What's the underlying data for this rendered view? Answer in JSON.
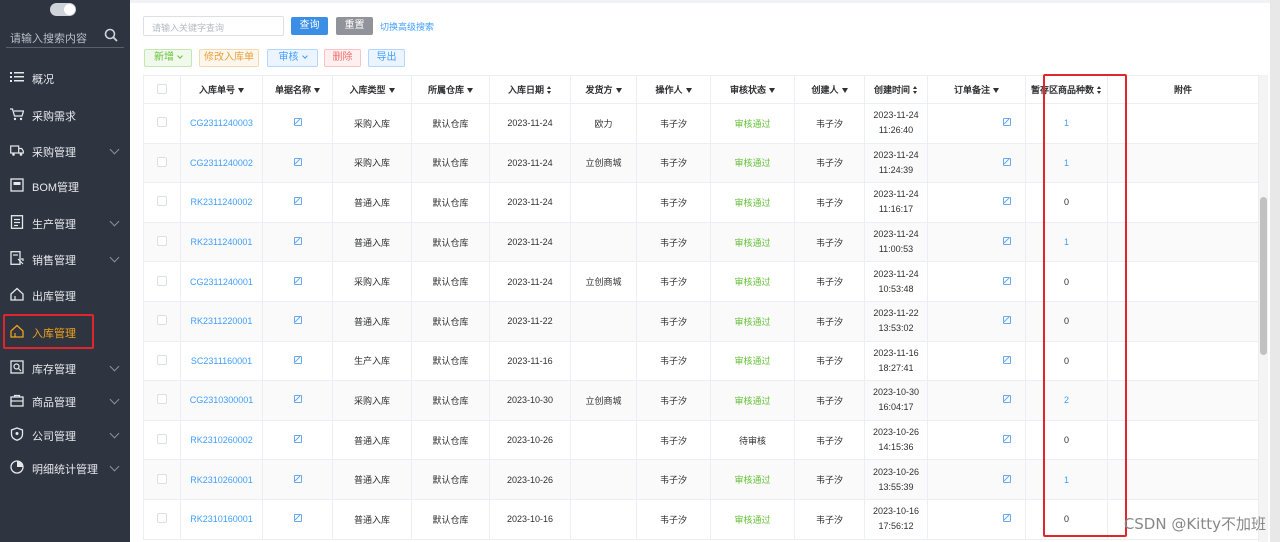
{
  "sidebar": {
    "search_placeholder": "请输入搜索内容",
    "items": [
      {
        "label": "概况",
        "icon": "list-icon",
        "expandable": false,
        "active": false
      },
      {
        "label": "采购需求",
        "icon": "cart-icon",
        "expandable": false,
        "active": false
      },
      {
        "label": "采购管理",
        "icon": "truck-icon",
        "expandable": true,
        "active": false
      },
      {
        "label": "BOM管理",
        "icon": "box-icon",
        "expandable": false,
        "active": false
      },
      {
        "label": "生产管理",
        "icon": "document-icon",
        "expandable": true,
        "active": false
      },
      {
        "label": "销售管理",
        "icon": "sales-doc-icon",
        "expandable": true,
        "active": false
      },
      {
        "label": "出库管理",
        "icon": "house-out-icon",
        "expandable": false,
        "active": false
      },
      {
        "label": "入库管理",
        "icon": "house-in-icon",
        "expandable": false,
        "active": true
      },
      {
        "label": "库存管理",
        "icon": "stock-icon",
        "expandable": true,
        "active": false
      },
      {
        "label": "商品管理",
        "icon": "goods-icon",
        "expandable": true,
        "active": false
      },
      {
        "label": "公司管理",
        "icon": "shield-icon",
        "expandable": true,
        "active": false
      },
      {
        "label": "明细统计管理",
        "icon": "pie-chart-icon",
        "expandable": true,
        "active": false
      }
    ]
  },
  "toolbar": {
    "keyword_placeholder": "请输入关键字查询",
    "query_label": "查询",
    "reset_label": "重置",
    "advanced_label": "切换高级搜索",
    "new_label": "新增",
    "edit_label": "修改入库单",
    "audit_label": "审核",
    "delete_label": "删除",
    "export_label": "导出"
  },
  "table": {
    "columns": [
      "入库单号",
      "单据名称",
      "入库类型",
      "所属仓库",
      "入库日期",
      "发货方",
      "操作人",
      "审核状态",
      "创建人",
      "创建时间",
      "订单备注",
      "暂存区商品种数",
      "附件"
    ],
    "rows": [
      {
        "no": "CG2311240003",
        "type": "采购入库",
        "wh": "默认仓库",
        "date": "2023-11-24",
        "sender": "欧力",
        "op": "韦子汐",
        "status": "审核通过",
        "creator": "韦子汐",
        "time1": "2023-11-24",
        "time2": "11:26:40",
        "count": "1"
      },
      {
        "no": "CG2311240002",
        "type": "采购入库",
        "wh": "默认仓库",
        "date": "2023-11-24",
        "sender": "立创商城",
        "op": "韦子汐",
        "status": "审核通过",
        "creator": "韦子汐",
        "time1": "2023-11-24",
        "time2": "11:24:39",
        "count": "1"
      },
      {
        "no": "RK2311240002",
        "type": "普通入库",
        "wh": "默认仓库",
        "date": "2023-11-24",
        "sender": "",
        "op": "韦子汐",
        "status": "审核通过",
        "creator": "韦子汐",
        "time1": "2023-11-24",
        "time2": "11:16:17",
        "count": "0"
      },
      {
        "no": "RK2311240001",
        "type": "普通入库",
        "wh": "默认仓库",
        "date": "2023-11-24",
        "sender": "",
        "op": "韦子汐",
        "status": "审核通过",
        "creator": "韦子汐",
        "time1": "2023-11-24",
        "time2": "11:00:53",
        "count": "1"
      },
      {
        "no": "CG2311240001",
        "type": "采购入库",
        "wh": "默认仓库",
        "date": "2023-11-24",
        "sender": "立创商城",
        "op": "韦子汐",
        "status": "审核通过",
        "creator": "韦子汐",
        "time1": "2023-11-24",
        "time2": "10:53:48",
        "count": "0"
      },
      {
        "no": "RK2311220001",
        "type": "普通入库",
        "wh": "默认仓库",
        "date": "2023-11-22",
        "sender": "",
        "op": "韦子汐",
        "status": "审核通过",
        "creator": "韦子汐",
        "time1": "2023-11-22",
        "time2": "13:53:02",
        "count": "0"
      },
      {
        "no": "SC2311160001",
        "type": "生产入库",
        "wh": "默认仓库",
        "date": "2023-11-16",
        "sender": "",
        "op": "韦子汐",
        "status": "审核通过",
        "creator": "韦子汐",
        "time1": "2023-11-16",
        "time2": "18:27:41",
        "count": "0"
      },
      {
        "no": "CG2310300001",
        "type": "采购入库",
        "wh": "默认仓库",
        "date": "2023-10-30",
        "sender": "立创商城",
        "op": "韦子汐",
        "status": "审核通过",
        "creator": "韦子汐",
        "time1": "2023-10-30",
        "time2": "16:04:17",
        "count": "2"
      },
      {
        "no": "RK2310260002",
        "type": "普通入库",
        "wh": "默认仓库",
        "date": "2023-10-26",
        "sender": "",
        "op": "韦子汐",
        "status": "待审核",
        "creator": "韦子汐",
        "time1": "2023-10-26",
        "time2": "14:15:36",
        "count": "0"
      },
      {
        "no": "RK2310260001",
        "type": "普通入库",
        "wh": "默认仓库",
        "date": "2023-10-26",
        "sender": "",
        "op": "韦子汐",
        "status": "审核通过",
        "creator": "韦子汐",
        "time1": "2023-10-26",
        "time2": "13:55:39",
        "count": "1"
      },
      {
        "no": "RK2310160001",
        "type": "普通入库",
        "wh": "默认仓库",
        "date": "2023-10-16",
        "sender": "",
        "op": "韦子汐",
        "status": "审核通过",
        "creator": "韦子汐",
        "time1": "2023-10-16",
        "time2": "17:56:12",
        "count": "0"
      }
    ]
  },
  "watermark": "CSDN @Kitty不加班",
  "colors": {
    "sidebar_bg": "#2e3440",
    "active_menu": "#f2a31a",
    "highlight": "#e0262c",
    "link": "#409eff",
    "approved": "#67c23a"
  }
}
